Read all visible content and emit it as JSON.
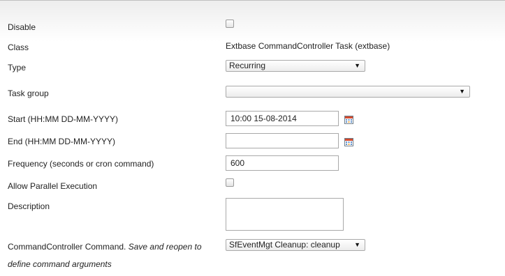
{
  "form": {
    "disable": {
      "label": "Disable",
      "checked": false
    },
    "class": {
      "label": "Class",
      "value": "Extbase CommandController Task (extbase)"
    },
    "type": {
      "label": "Type",
      "selected": "Recurring"
    },
    "task_group": {
      "label": "Task group",
      "selected": ""
    },
    "start": {
      "label": "Start (HH:MM DD-MM-YYYY)",
      "value": "10:00 15-08-2014"
    },
    "end": {
      "label": "End (HH:MM DD-MM-YYYY)",
      "value": ""
    },
    "frequency": {
      "label": "Frequency (seconds or cron command)",
      "value": "600"
    },
    "parallel": {
      "label": "Allow Parallel Execution",
      "checked": false
    },
    "description": {
      "label": "Description",
      "value": ""
    },
    "command": {
      "label": "CommandController Command.",
      "hint_line1": "Save and reopen to",
      "hint_line2": "define command arguments",
      "selected": "SfEventMgt Cleanup: cleanup"
    }
  },
  "icons": {
    "dropdown_arrow": "▼",
    "calendar": "calendar-icon"
  }
}
